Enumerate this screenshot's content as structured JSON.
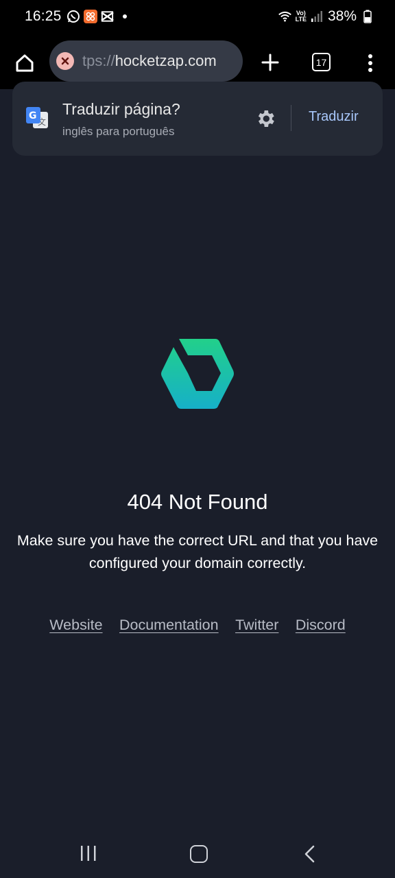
{
  "status_bar": {
    "time": "16:25",
    "battery": "38%",
    "network_label_top": "Vo)",
    "network_label_bottom": "LTE",
    "icons": [
      "whatsapp-icon",
      "app-icon",
      "capcut-icon",
      "wifi-icon",
      "signal-icon",
      "battery-icon"
    ]
  },
  "browser": {
    "url_prefix": "tps://",
    "url_domain": "hocketzap.com",
    "tab_count": "17",
    "icons": [
      "home-icon",
      "error-icon",
      "plus-icon",
      "more-vert-icon"
    ]
  },
  "translate_prompt": {
    "title": "Traduzir página?",
    "subtitle": "inglês para português",
    "action": "Traduzir",
    "icons": [
      "google-translate-icon",
      "gear-icon"
    ]
  },
  "page": {
    "title": "404 Not Found",
    "message": "Make sure you have the correct URL and that you have configured your domain correctly.",
    "links": [
      "Website",
      "Documentation",
      "Twitter",
      "Discord"
    ],
    "logo_colors": [
      "#1fcf8a",
      "#18b4c8"
    ]
  },
  "nav_bar": {
    "icons": [
      "recents-icon",
      "home-circle-icon",
      "back-icon"
    ]
  }
}
